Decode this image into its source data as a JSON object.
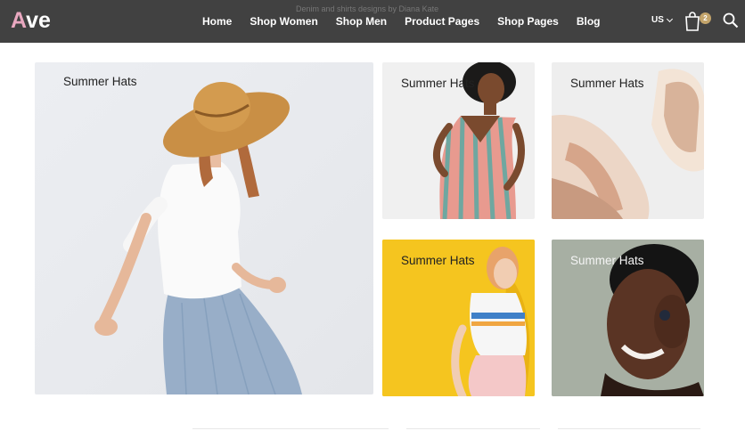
{
  "brand": {
    "logo_part1": "A",
    "logo_part2": "ve"
  },
  "banner_text": "Denim and shirts designs by Diana Kate",
  "nav": [
    "Home",
    "Shop Women",
    "Shop Men",
    "Product Pages",
    "Shop Pages",
    "Blog"
  ],
  "currency": "US",
  "cart": {
    "count": "2"
  },
  "tiles": [
    {
      "label": "Summer Hats"
    },
    {
      "label": "Summer Hats"
    },
    {
      "label": "Summer Hats"
    },
    {
      "label": "Summer Hats"
    },
    {
      "label": "Summer Hats"
    }
  ],
  "colors": {
    "header_bg": "#414141",
    "accent_pink": "#e9a8c0",
    "cart_badge": "#c3a46b",
    "yellow_tile": "#f4c21c"
  },
  "icons": {
    "cart": "shopping-bag-icon",
    "search": "search-icon",
    "currency": "chevron-down-icon"
  }
}
